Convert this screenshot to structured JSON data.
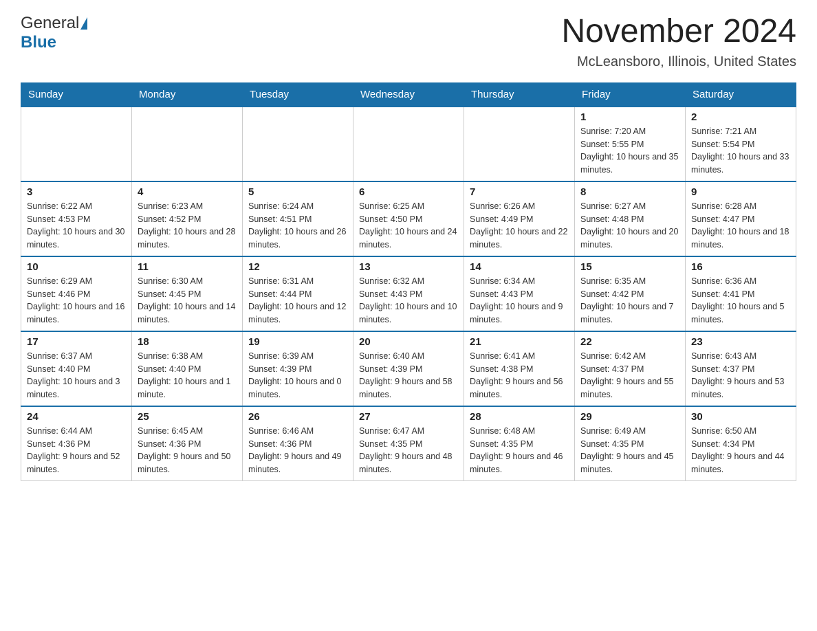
{
  "header": {
    "logo_general": "General",
    "logo_blue": "Blue",
    "main_title": "November 2024",
    "subtitle": "McLeansboro, Illinois, United States"
  },
  "calendar": {
    "days_of_week": [
      "Sunday",
      "Monday",
      "Tuesday",
      "Wednesday",
      "Thursday",
      "Friday",
      "Saturday"
    ],
    "weeks": [
      [
        {
          "day": "",
          "info": ""
        },
        {
          "day": "",
          "info": ""
        },
        {
          "day": "",
          "info": ""
        },
        {
          "day": "",
          "info": ""
        },
        {
          "day": "",
          "info": ""
        },
        {
          "day": "1",
          "info": "Sunrise: 7:20 AM\nSunset: 5:55 PM\nDaylight: 10 hours and 35 minutes."
        },
        {
          "day": "2",
          "info": "Sunrise: 7:21 AM\nSunset: 5:54 PM\nDaylight: 10 hours and 33 minutes."
        }
      ],
      [
        {
          "day": "3",
          "info": "Sunrise: 6:22 AM\nSunset: 4:53 PM\nDaylight: 10 hours and 30 minutes."
        },
        {
          "day": "4",
          "info": "Sunrise: 6:23 AM\nSunset: 4:52 PM\nDaylight: 10 hours and 28 minutes."
        },
        {
          "day": "5",
          "info": "Sunrise: 6:24 AM\nSunset: 4:51 PM\nDaylight: 10 hours and 26 minutes."
        },
        {
          "day": "6",
          "info": "Sunrise: 6:25 AM\nSunset: 4:50 PM\nDaylight: 10 hours and 24 minutes."
        },
        {
          "day": "7",
          "info": "Sunrise: 6:26 AM\nSunset: 4:49 PM\nDaylight: 10 hours and 22 minutes."
        },
        {
          "day": "8",
          "info": "Sunrise: 6:27 AM\nSunset: 4:48 PM\nDaylight: 10 hours and 20 minutes."
        },
        {
          "day": "9",
          "info": "Sunrise: 6:28 AM\nSunset: 4:47 PM\nDaylight: 10 hours and 18 minutes."
        }
      ],
      [
        {
          "day": "10",
          "info": "Sunrise: 6:29 AM\nSunset: 4:46 PM\nDaylight: 10 hours and 16 minutes."
        },
        {
          "day": "11",
          "info": "Sunrise: 6:30 AM\nSunset: 4:45 PM\nDaylight: 10 hours and 14 minutes."
        },
        {
          "day": "12",
          "info": "Sunrise: 6:31 AM\nSunset: 4:44 PM\nDaylight: 10 hours and 12 minutes."
        },
        {
          "day": "13",
          "info": "Sunrise: 6:32 AM\nSunset: 4:43 PM\nDaylight: 10 hours and 10 minutes."
        },
        {
          "day": "14",
          "info": "Sunrise: 6:34 AM\nSunset: 4:43 PM\nDaylight: 10 hours and 9 minutes."
        },
        {
          "day": "15",
          "info": "Sunrise: 6:35 AM\nSunset: 4:42 PM\nDaylight: 10 hours and 7 minutes."
        },
        {
          "day": "16",
          "info": "Sunrise: 6:36 AM\nSunset: 4:41 PM\nDaylight: 10 hours and 5 minutes."
        }
      ],
      [
        {
          "day": "17",
          "info": "Sunrise: 6:37 AM\nSunset: 4:40 PM\nDaylight: 10 hours and 3 minutes."
        },
        {
          "day": "18",
          "info": "Sunrise: 6:38 AM\nSunset: 4:40 PM\nDaylight: 10 hours and 1 minute."
        },
        {
          "day": "19",
          "info": "Sunrise: 6:39 AM\nSunset: 4:39 PM\nDaylight: 10 hours and 0 minutes."
        },
        {
          "day": "20",
          "info": "Sunrise: 6:40 AM\nSunset: 4:39 PM\nDaylight: 9 hours and 58 minutes."
        },
        {
          "day": "21",
          "info": "Sunrise: 6:41 AM\nSunset: 4:38 PM\nDaylight: 9 hours and 56 minutes."
        },
        {
          "day": "22",
          "info": "Sunrise: 6:42 AM\nSunset: 4:37 PM\nDaylight: 9 hours and 55 minutes."
        },
        {
          "day": "23",
          "info": "Sunrise: 6:43 AM\nSunset: 4:37 PM\nDaylight: 9 hours and 53 minutes."
        }
      ],
      [
        {
          "day": "24",
          "info": "Sunrise: 6:44 AM\nSunset: 4:36 PM\nDaylight: 9 hours and 52 minutes."
        },
        {
          "day": "25",
          "info": "Sunrise: 6:45 AM\nSunset: 4:36 PM\nDaylight: 9 hours and 50 minutes."
        },
        {
          "day": "26",
          "info": "Sunrise: 6:46 AM\nSunset: 4:36 PM\nDaylight: 9 hours and 49 minutes."
        },
        {
          "day": "27",
          "info": "Sunrise: 6:47 AM\nSunset: 4:35 PM\nDaylight: 9 hours and 48 minutes."
        },
        {
          "day": "28",
          "info": "Sunrise: 6:48 AM\nSunset: 4:35 PM\nDaylight: 9 hours and 46 minutes."
        },
        {
          "day": "29",
          "info": "Sunrise: 6:49 AM\nSunset: 4:35 PM\nDaylight: 9 hours and 45 minutes."
        },
        {
          "day": "30",
          "info": "Sunrise: 6:50 AM\nSunset: 4:34 PM\nDaylight: 9 hours and 44 minutes."
        }
      ]
    ]
  }
}
